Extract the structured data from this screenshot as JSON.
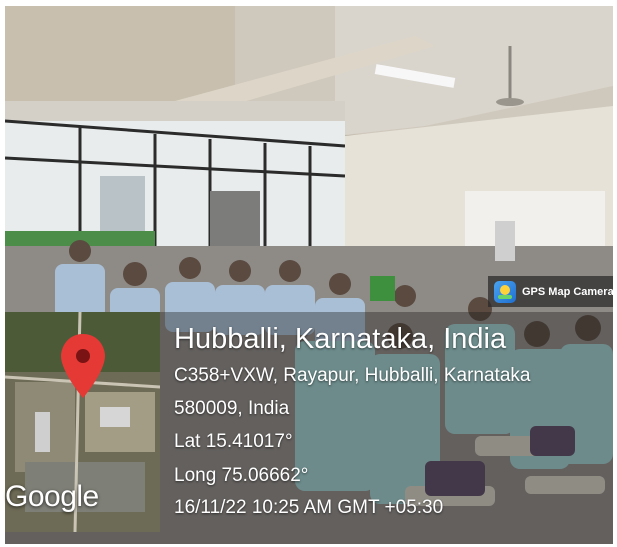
{
  "badge": {
    "label": "GPS Map Camera",
    "icon": "gps-map-camera-icon"
  },
  "location": {
    "title": "Hubballi, Karnataka, India",
    "address_line": "C358+VXW, Rayapur, Hubballi, Karnataka",
    "postal_line": "580009, India",
    "latitude": "Lat 15.41017°",
    "longitude": "Long 75.06662°",
    "datetime": "16/11/22 10:25 AM GMT +05:30"
  },
  "map": {
    "provider_label": "Google",
    "pin_icon": "map-pin-icon",
    "pin_color": "#e53935"
  },
  "colors": {
    "overlay": "#1e1e1e",
    "text": "#ffffff"
  }
}
